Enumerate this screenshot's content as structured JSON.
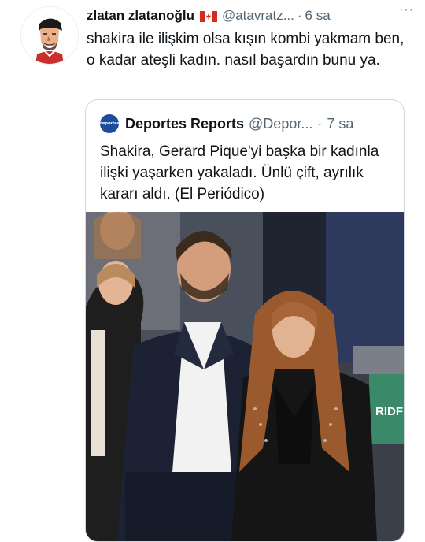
{
  "tweet": {
    "display_name": "zlatan zlatanoğlu",
    "flag_icon": "canada-flag-icon",
    "handle": "@atavratz...",
    "separator": "·",
    "time": "6 sa",
    "more_icon": "more-dots-icon",
    "text": "shakira ile ilişkim olsa kışın kombi yakmam ben, o kadar ateşli kadın. nasıl başardın bunu ya."
  },
  "quote": {
    "display_name": "Deportes Reports",
    "handle": "@Depor...",
    "separator": "·",
    "time": "7 sa",
    "avatar_text": "deportes",
    "text": "Shakira, Gerard Pique'yi başka bir kadınla ilişki yaşarken yakaladı. Ünlü çift, ayrılık kararı aldı. (El Periódico)",
    "photo_banner_text": "RIDF"
  },
  "colors": {
    "text_primary": "#0f1419",
    "text_secondary": "#536471",
    "border": "#cfd9de",
    "quote_avatar": "#1d4c9b"
  }
}
